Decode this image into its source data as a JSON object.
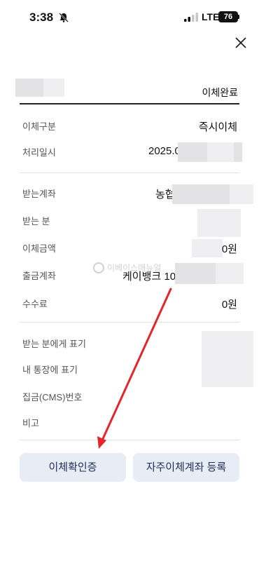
{
  "status_bar": {
    "time": "3:38",
    "network": "LTE",
    "battery": "76"
  },
  "header": {
    "status": "이체완료"
  },
  "section1": {
    "transfer_type_label": "이체구분",
    "transfer_type_value": "즉시이체",
    "processed_date_label": "처리일시",
    "processed_date_value": "2025.0"
  },
  "section2": {
    "recipient_account_label": "받는계좌",
    "recipient_account_value": "농협",
    "recipient_label": "받는 분",
    "amount_label": "이체금액",
    "amount_value": "0원",
    "withdraw_account_label": "출금계좌",
    "withdraw_account_value": "케이뱅크 100",
    "fee_label": "수수료",
    "fee_value": "0원"
  },
  "watermark": "이베이스매뉴얼",
  "section3": {
    "recipient_memo_label": "받는 분에게 표기",
    "my_memo_label": "내 통장에 표기",
    "cms_label": "집금(CMS)번호",
    "note_label": "비고"
  },
  "actions": {
    "confirm_label": "이체확인증",
    "register_label": "자주이체계좌 등록"
  },
  "colors": {
    "button_bg": "#e8edf5",
    "button_text": "#1c2d57",
    "annotation_arrow": "#e3262a"
  }
}
